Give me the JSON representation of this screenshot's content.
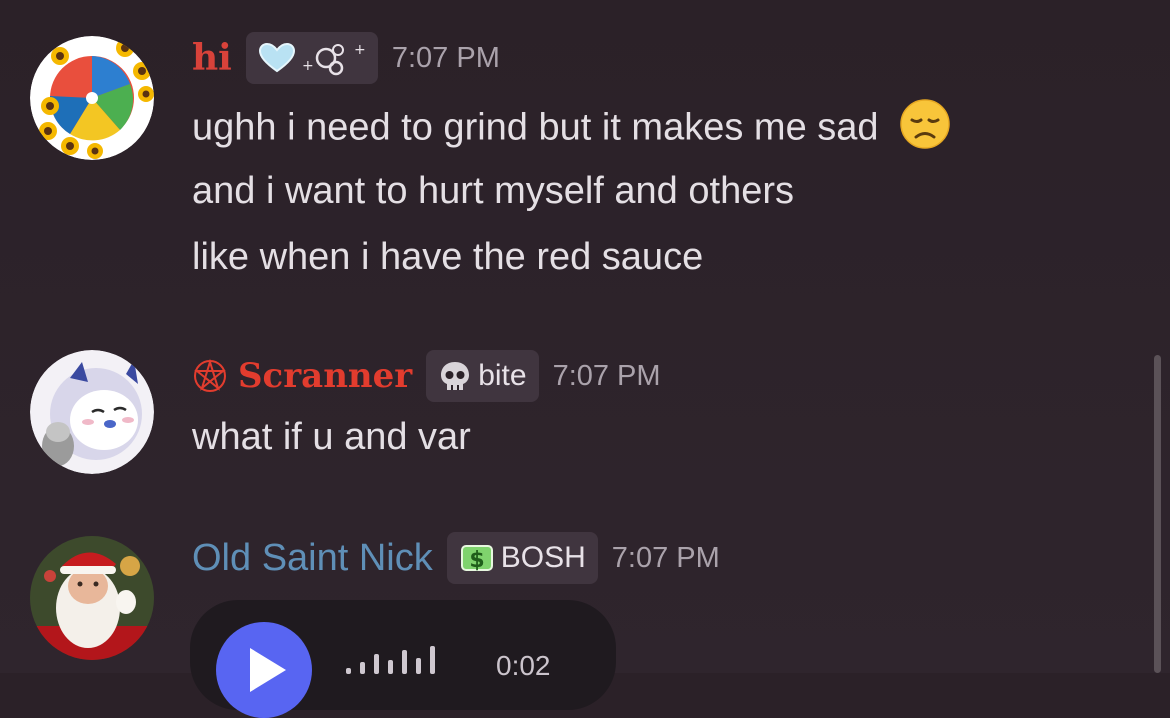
{
  "messages": [
    {
      "author": "hi",
      "author_color": "#d8423a",
      "tag": "",
      "tag_icons": [
        "heart-icon",
        "bubbles-icon"
      ],
      "time": "7:07 PM",
      "lines": [
        "ughh i need to grind but it makes me sad",
        "and i want to hurt myself and others",
        "like when i have the red sauce"
      ],
      "emoji": "disappointed-face-emoji"
    },
    {
      "author": "Scranner",
      "author_color": "#e23c2e",
      "author_icon": "pentagram-icon",
      "tag": "bite",
      "tag_icon": "skull-icon",
      "time": "7:07 PM",
      "lines": [
        "what if u and var"
      ]
    },
    {
      "author": "Old Saint Nick",
      "author_color": "#5f8fb7",
      "tag": "BOSH",
      "tag_icon": "money-icon",
      "time": "7:07 PM",
      "voice_message": {
        "duration": "0:02",
        "icon": "play-icon",
        "accent": "#5865f2"
      }
    }
  ]
}
